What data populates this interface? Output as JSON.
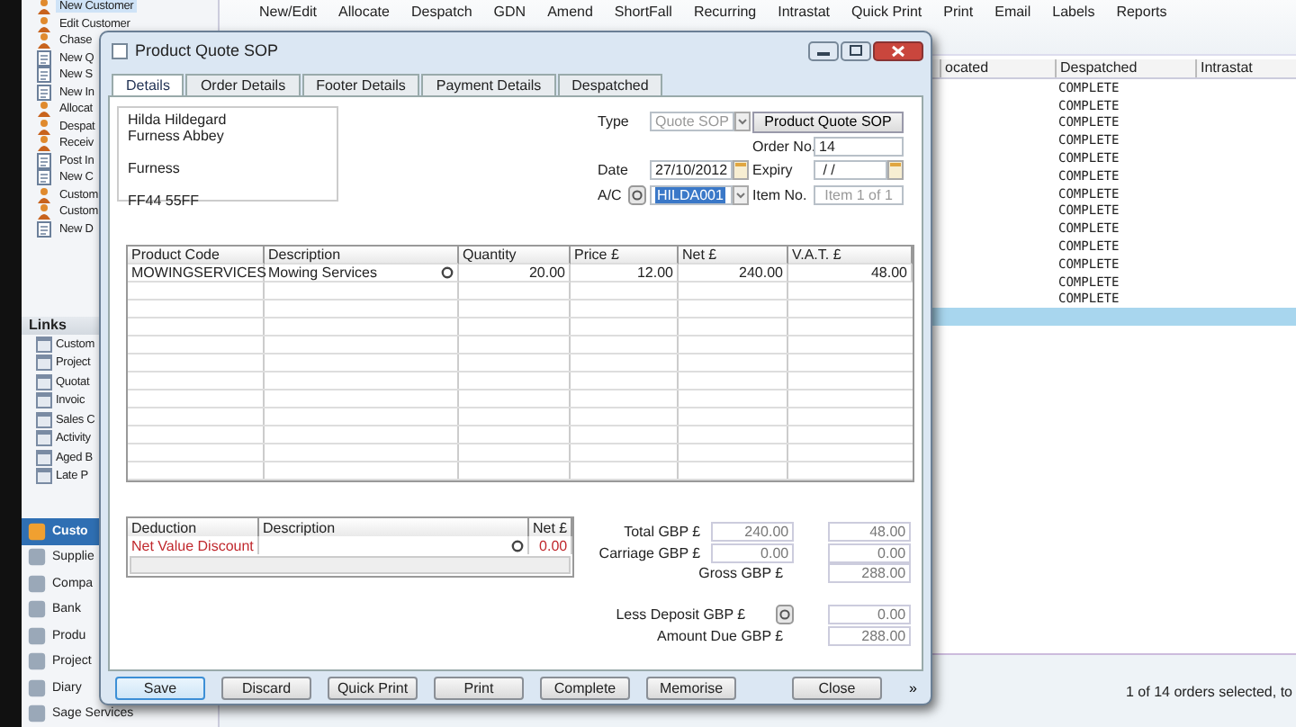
{
  "app": {
    "toolbar": [
      "New/Edit",
      "Allocate",
      "Despatch",
      "GDN",
      "Amend",
      "ShortFall",
      "Recurring",
      "Intrastat",
      "Quick Print",
      "Print",
      "Email",
      "Labels",
      "Reports"
    ],
    "sidebar": {
      "tasks": [
        {
          "label": "New Customer",
          "kind": "person",
          "selected": true
        },
        {
          "label": "Edit Customer",
          "kind": "person",
          "selected": false
        },
        {
          "label": "Chase",
          "kind": "person",
          "selected": false
        },
        {
          "label": "New Q",
          "kind": "document",
          "selected": false
        },
        {
          "label": "New S",
          "kind": "document",
          "selected": false
        },
        {
          "label": "New In",
          "kind": "document",
          "selected": false
        },
        {
          "label": "Allocat",
          "kind": "person",
          "selected": false
        },
        {
          "label": "Despat",
          "kind": "person",
          "selected": false
        },
        {
          "label": "Receiv",
          "kind": "person",
          "selected": false
        },
        {
          "label": "Post In",
          "kind": "document",
          "selected": false
        },
        {
          "label": "New C",
          "kind": "document",
          "selected": false
        },
        {
          "label": "Custom",
          "kind": "person",
          "selected": false
        },
        {
          "label": "Custom",
          "kind": "person",
          "selected": false
        },
        {
          "label": "New D",
          "kind": "document",
          "selected": false
        }
      ],
      "links_title": "Links",
      "links": [
        "Custom",
        "Project",
        "Quotat",
        "Invoic",
        "Sales C",
        "Activity",
        "Aged B",
        "Late P"
      ],
      "nav": [
        {
          "label": "Custo",
          "selected": true
        },
        {
          "label": "Supplie",
          "selected": false
        },
        {
          "label": "Compa",
          "selected": false
        },
        {
          "label": "Bank",
          "selected": false
        },
        {
          "label": "Produ",
          "selected": false
        },
        {
          "label": "Project",
          "selected": false
        },
        {
          "label": "Diary",
          "selected": false
        },
        {
          "label": "Sage Services",
          "selected": false
        }
      ]
    },
    "list": {
      "columns": [
        "ocated",
        "Despatched",
        "Intrastat"
      ],
      "rows": [
        {
          "despatched": "COMPLETE",
          "selected": false
        },
        {
          "despatched": "COMPLETE",
          "selected": false
        },
        {
          "despatched": "COMPLETE",
          "selected": false
        },
        {
          "despatched": "COMPLETE",
          "selected": false
        },
        {
          "despatched": "COMPLETE",
          "selected": false
        },
        {
          "despatched": "COMPLETE",
          "selected": false
        },
        {
          "despatched": "COMPLETE",
          "selected": false
        },
        {
          "despatched": "COMPLETE",
          "selected": false
        },
        {
          "despatched": "COMPLETE",
          "selected": false
        },
        {
          "despatched": "COMPLETE",
          "selected": false
        },
        {
          "despatched": "COMPLETE",
          "selected": false
        },
        {
          "despatched": "COMPLETE",
          "selected": false
        },
        {
          "despatched": "COMPLETE",
          "selected": false
        },
        {
          "selected": true
        }
      ]
    },
    "status_bar": "1 of 14 orders selected, to"
  },
  "dialog": {
    "title": "Product Quote SOP",
    "tabs": [
      {
        "label": "Details",
        "selected": true
      },
      {
        "label": "Order Details",
        "selected": false
      },
      {
        "label": "Footer Details",
        "selected": false
      },
      {
        "label": "Payment Details",
        "selected": false
      },
      {
        "label": "Despatched",
        "selected": false
      }
    ],
    "address": [
      [
        "Hilda Hildegard",
        "Furness Abbey"
      ],
      [
        "Furness"
      ],
      [
        "FF44 55FF"
      ]
    ],
    "type_label": "Type",
    "type_value": "Quote SOP",
    "type_button": "Product Quote SOP",
    "order_no_label": "Order No.",
    "order_no": "14",
    "date_label": "Date",
    "date": "27/10/2012",
    "expiry_label": "Expiry",
    "expiry": " / /",
    "ac_label": "A/C",
    "ac": "HILDA001",
    "item_no_label": "Item No.",
    "item_no": "Item 1 of 1",
    "items": {
      "columns": [
        "Product Code",
        "Description",
        "Quantity",
        "Price £",
        "Net £",
        "V.A.T. £"
      ],
      "rows": [
        [
          "MOWINGSERVICES",
          "Mowing Services",
          "20.00",
          "12.00",
          "240.00",
          "48.00"
        ]
      ]
    },
    "deductions": {
      "columns": [
        "Deduction",
        "Description",
        "Net £"
      ],
      "rows": [
        {
          "deduction": "Net Value Discount",
          "net": "0.00"
        }
      ]
    },
    "totals": [
      {
        "kind": "pair",
        "label": "Total GBP £",
        "values": [
          "240.00",
          "48.00"
        ]
      },
      {
        "kind": "pair",
        "label": "Carriage GBP £",
        "values": [
          "0.00",
          "0.00"
        ]
      },
      {
        "kind": "single",
        "label": "Gross GBP £",
        "values": [
          "288.00"
        ]
      },
      {
        "kind": "deposit",
        "label": "Less Deposit GBP £",
        "values": [
          "0.00"
        ]
      },
      {
        "kind": "due",
        "label": "Amount Due GBP £",
        "values": [
          "288.00"
        ]
      }
    ],
    "buttons": [
      {
        "label": "Save",
        "default": true
      },
      {
        "label": "Discard",
        "default": false
      },
      {
        "label": "Quick Print",
        "default": false
      },
      {
        "label": "Print",
        "default": false
      },
      {
        "label": "Complete",
        "default": false
      },
      {
        "label": "Memorise",
        "default": false
      }
    ],
    "close_button": "Close",
    "more": "»"
  }
}
